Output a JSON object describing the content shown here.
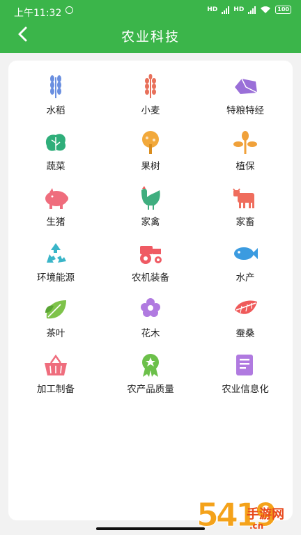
{
  "status_bar": {
    "time": "上午11:32",
    "signal1": "HD",
    "signal2": "HD",
    "battery": "100"
  },
  "header": {
    "title": "农业科技",
    "back_icon": "chevron-left-icon"
  },
  "colors": {
    "accent": "#3bb54a"
  },
  "categories": [
    {
      "label": "水稻",
      "icon": "rice-icon"
    },
    {
      "label": "小麦",
      "icon": "wheat-icon"
    },
    {
      "label": "特粮特经",
      "icon": "sweet-potato-icon"
    },
    {
      "label": "蔬菜",
      "icon": "vegetable-icon"
    },
    {
      "label": "果树",
      "icon": "fruit-tree-icon"
    },
    {
      "label": "植保",
      "icon": "plant-protection-icon"
    },
    {
      "label": "生猪",
      "icon": "pig-icon"
    },
    {
      "label": "家禽",
      "icon": "rooster-icon"
    },
    {
      "label": "家畜",
      "icon": "cow-icon"
    },
    {
      "label": "环境能源",
      "icon": "recycle-icon"
    },
    {
      "label": "农机装备",
      "icon": "tractor-icon"
    },
    {
      "label": "水产",
      "icon": "fish-icon"
    },
    {
      "label": "茶叶",
      "icon": "tea-leaf-icon"
    },
    {
      "label": "花木",
      "icon": "flower-icon"
    },
    {
      "label": "蚕桑",
      "icon": "silkworm-leaf-icon"
    },
    {
      "label": "加工制备",
      "icon": "basket-icon"
    },
    {
      "label": "农产品质量",
      "icon": "quality-badge-icon"
    },
    {
      "label": "农业信息化",
      "icon": "document-icon"
    }
  ],
  "watermark": {
    "number": "5419",
    "text": "手游网",
    "domain": ".cn"
  }
}
